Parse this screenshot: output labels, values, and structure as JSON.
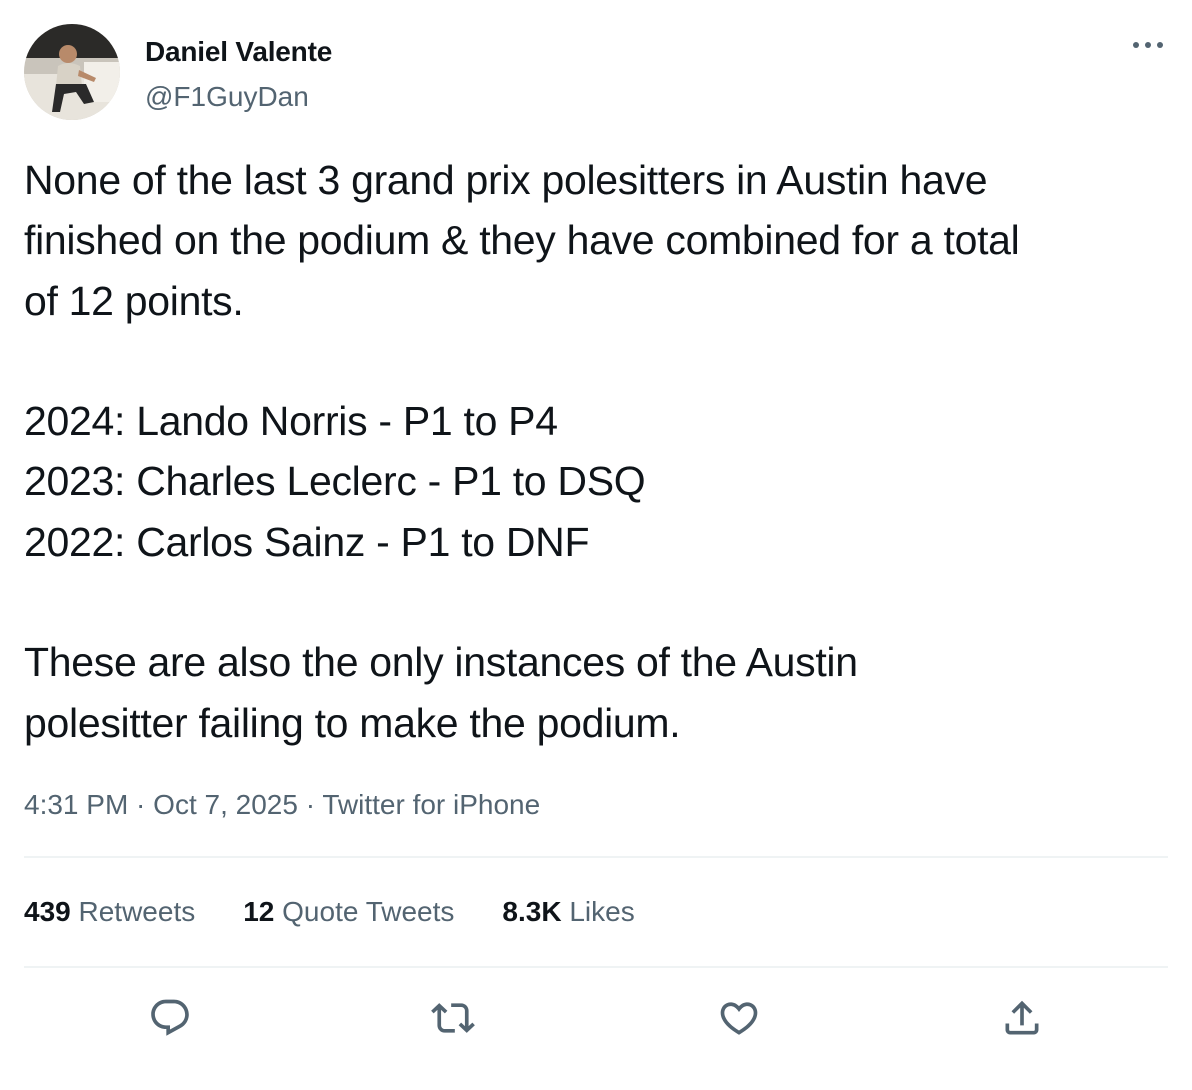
{
  "user": {
    "display_name": "Daniel Valente",
    "handle": "@F1GuyDan",
    "avatar_icon": "profile-photo"
  },
  "tweet": {
    "lines": [
      "None of the last 3 grand prix polesitters in Austin have",
      "finished on the podium & they have combined for a total",
      "of 12 points.",
      "",
      "2024: Lando Norris - P1 to P4",
      "2023: Charles Leclerc - P1 to DSQ",
      "2022: Carlos Sainz - P1 to DNF",
      "",
      "These are also the only instances of the Austin",
      "polesitter failing to make the podium."
    ]
  },
  "meta": {
    "time": "4:31 PM",
    "separator": " · ",
    "date": "Oct 7, 2025",
    "source": "Twitter for iPhone"
  },
  "stats": {
    "retweets_count": "439",
    "retweets_label": "Retweets",
    "quotes_count": "12",
    "quotes_label": "Quote Tweets",
    "likes_count": "8.3K",
    "likes_label": "Likes"
  },
  "actions": {
    "reply_icon": "reply-icon",
    "retweet_icon": "retweet-icon",
    "like_icon": "heart-icon",
    "share_icon": "share-icon",
    "more_icon": "more-icon"
  },
  "colors": {
    "text_primary": "#0f1419",
    "text_secondary": "#536471",
    "divider": "#eff3f4"
  }
}
